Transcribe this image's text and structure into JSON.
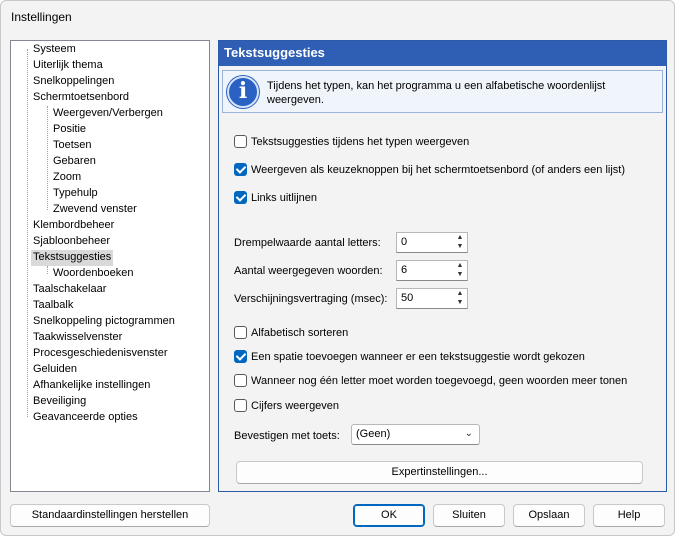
{
  "window": {
    "title": "Instellingen"
  },
  "tree": {
    "items": [
      {
        "label": "Systeem"
      },
      {
        "label": "Uiterlijk thema"
      },
      {
        "label": "Snelkoppelingen"
      },
      {
        "label": "Schermtoetsenbord"
      },
      {
        "label": "Weergeven/Verbergen"
      },
      {
        "label": "Positie"
      },
      {
        "label": "Toetsen"
      },
      {
        "label": "Gebaren"
      },
      {
        "label": "Zoom"
      },
      {
        "label": "Typehulp"
      },
      {
        "label": "Zwevend venster"
      },
      {
        "label": "Klembordbeheer"
      },
      {
        "label": "Sjabloonbeheer"
      },
      {
        "label": "Tekstsuggesties"
      },
      {
        "label": "Woordenboeken"
      },
      {
        "label": "Taalschakelaar"
      },
      {
        "label": "Taalbalk"
      },
      {
        "label": "Snelkoppeling pictogrammen"
      },
      {
        "label": "Taakwisselvenster"
      },
      {
        "label": "Procesgeschiedenisvenster"
      },
      {
        "label": "Geluiden"
      },
      {
        "label": "Afhankelijke instellingen"
      },
      {
        "label": "Beveiliging"
      },
      {
        "label": "Geavanceerde opties"
      }
    ],
    "selected": "Tekstsuggesties"
  },
  "panel": {
    "header": "Tekstsuggesties",
    "info_text": "Tijdens het typen, kan het programma u een alfabetische woordenlijst weergeven.",
    "checkboxes": [
      {
        "label": "Tekstsuggesties tijdens het typen weergeven",
        "checked": false
      },
      {
        "label": "Weergeven als keuzeknoppen bij het schermtoetsenbord (of anders een lijst)",
        "checked": true
      },
      {
        "label": "Links uitlijnen",
        "checked": true
      },
      {
        "label": "Alfabetisch sorteren",
        "checked": false
      },
      {
        "label": "Een spatie toevoegen wanneer er een tekstsuggestie wordt gekozen",
        "checked": true
      },
      {
        "label": "Wanneer nog één letter moet worden toegevoegd, geen woorden meer tonen",
        "checked": false
      },
      {
        "label": "Cijfers weergeven",
        "checked": false
      }
    ],
    "spinners": [
      {
        "label": "Drempelwaarde aantal letters:",
        "value": "0"
      },
      {
        "label": "Aantal weergegeven woorden:",
        "value": "6"
      },
      {
        "label": "Verschijningsvertraging (msec):",
        "value": "50"
      }
    ],
    "confirm_label": "Bevestigen met toets:",
    "confirm_value": "(Geen)",
    "expert_button": "Expertinstellingen..."
  },
  "footer": {
    "reset": "Standaardinstellingen herstellen",
    "ok": "OK",
    "close": "Sluiten",
    "save": "Opslaan",
    "help": "Help"
  },
  "colors": {
    "accent": "#2f5fb5",
    "checkbox": "#0067c0"
  }
}
